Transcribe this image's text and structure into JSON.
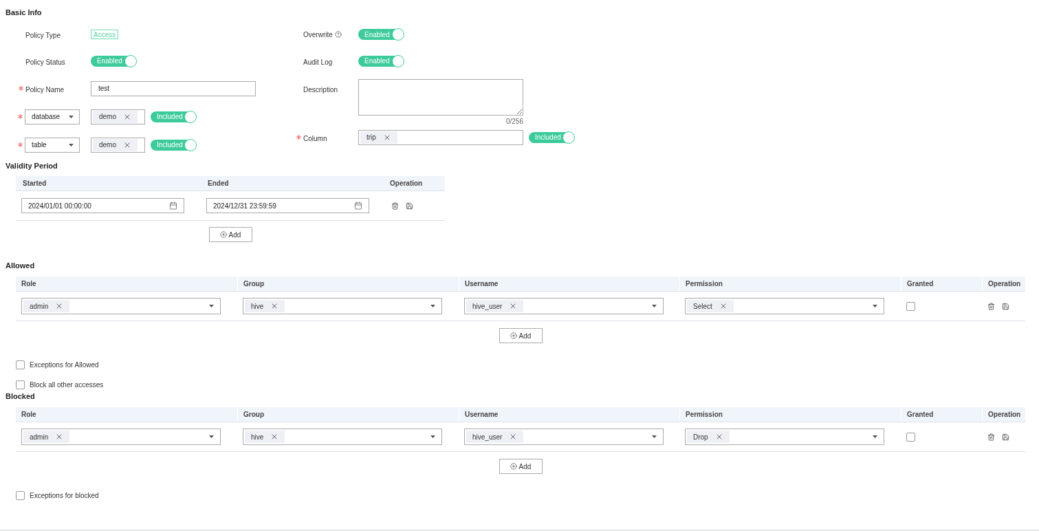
{
  "basic_info": {
    "title": "Basic Info",
    "policy_type": {
      "label": "Policy Type",
      "value": "Access"
    },
    "policy_status": {
      "label": "Policy Status",
      "text": "Enabled",
      "on": true
    },
    "policy_name": {
      "label": "Policy Name",
      "required": true,
      "value": "test"
    },
    "resources": [
      {
        "type": "database",
        "required": true,
        "tags": [
          "demo"
        ],
        "toggle": {
          "text": "Included",
          "on": true
        }
      },
      {
        "type": "table",
        "required": true,
        "tags": [
          "demo"
        ],
        "toggle": {
          "text": "Included",
          "on": true
        }
      }
    ],
    "overwrite": {
      "label": "Overwrite",
      "text": "Enabled",
      "on": true
    },
    "audit_log": {
      "label": "Audit Log",
      "text": "Enabled",
      "on": true
    },
    "description": {
      "label": "Description",
      "counter": "0/256"
    },
    "column": {
      "label": "Column",
      "required": true,
      "tags": [
        "trip"
      ],
      "toggle": {
        "text": "Included",
        "on": true
      }
    }
  },
  "validity_period": {
    "title": "Validity Period",
    "columns": [
      "Started",
      "Ended",
      "Operation"
    ],
    "rows": [
      {
        "start": "2024/01/01 00:00:00",
        "end": "2024/12/31 23:59:59"
      }
    ],
    "add_button": "Add"
  },
  "allowed": {
    "title": "Allowed",
    "columns": [
      "Role",
      "Group",
      "Username",
      "Permission",
      "Granted",
      "Operation"
    ],
    "rows": [
      {
        "role": [
          "admin"
        ],
        "group": [
          "hive"
        ],
        "username": [
          "hive_user"
        ],
        "permission": [
          "Select"
        ],
        "granted": false
      }
    ],
    "add_button": "Add",
    "options": [
      {
        "label": "Exceptions for Allowed",
        "checked": false
      },
      {
        "label": "Block all other accesses",
        "checked": false
      }
    ]
  },
  "blocked": {
    "title": "Blocked",
    "columns": [
      "Role",
      "Group",
      "Username",
      "Permission",
      "Granted",
      "Operation"
    ],
    "rows": [
      {
        "role": [
          "admin"
        ],
        "group": [
          "hive"
        ],
        "username": [
          "hive_user"
        ],
        "permission": [
          "Drop"
        ],
        "granted": false
      }
    ],
    "add_button": "Add",
    "options": [
      {
        "label": "Exceptions for blocked",
        "checked": false
      }
    ]
  }
}
